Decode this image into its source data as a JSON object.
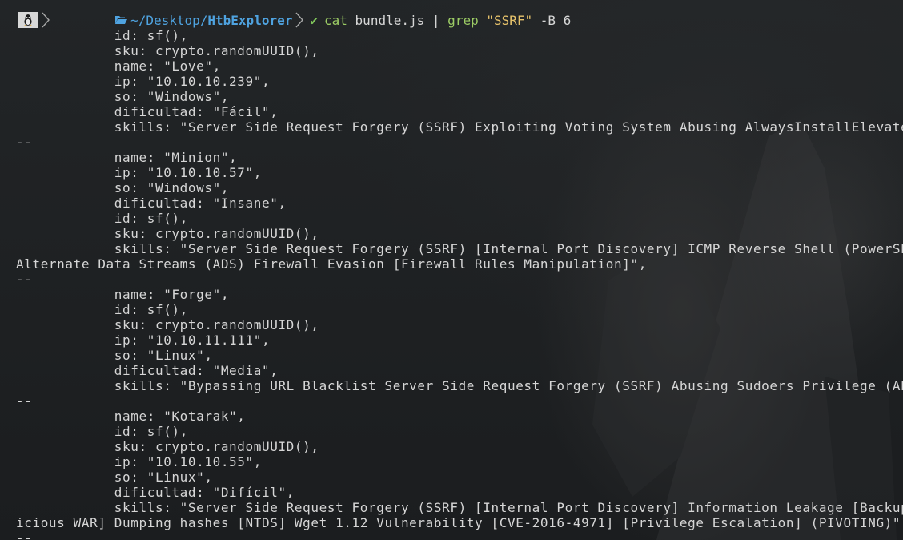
{
  "prompt": {
    "os_icon": "linux-tux-icon",
    "path_icon": "folder-open-icon",
    "path_prefix": "~/Desktop/",
    "path_dir": "HtbExplorer",
    "status_icon": "check-icon",
    "status_glyph": "✔",
    "command": {
      "bin": "cat",
      "file": "bundle.js",
      "pipe": "|",
      "grep": "grep",
      "pattern": "\"SSRF\"",
      "flags": "-B 6"
    }
  },
  "output": [
    "            id: sf(),",
    "            sku: crypto.randomUUID(),",
    "            name: \"Love\",",
    "            ip: \"10.10.10.239\",",
    "            so: \"Windows\",",
    "            dificultad: \"Fácil\",",
    "            skills: \"Server Side Request Forgery (SSRF) Exploiting Voting System Abusing AlwaysInstallElevated",
    "--",
    "            name: \"Minion\",",
    "            ip: \"10.10.10.57\",",
    "            so: \"Windows\",",
    "            dificultad: \"Insane\",",
    "            id: sf(),",
    "            sku: crypto.randomUUID(),",
    "            skills: \"Server Side Request Forgery (SSRF) [Internal Port Discovery] ICMP Reverse Shell (PowerShel",
    "Alternate Data Streams (ADS) Firewall Evasion [Firewall Rules Manipulation]\",",
    "--",
    "            name: \"Forge\",",
    "            id: sf(),",
    "            sku: crypto.randomUUID(),",
    "            ip: \"10.10.11.111\",",
    "            so: \"Linux\",",
    "            dificultad: \"Media\",",
    "            skills: \"Bypassing URL Blacklist Server Side Request Forgery (SSRF) Abusing Sudoers Privilege (Abus",
    "--",
    "            name: \"Kotarak\",",
    "            id: sf(),",
    "            sku: crypto.randomUUID(),",
    "            ip: \"10.10.10.55\",",
    "            so: \"Linux\",",
    "            dificultad: \"Difícil\",",
    "            skills: \"Server Side Request Forgery (SSRF) [Internal Port Discovery] Information Leakage [Backup]",
    "icious WAR] Dumping hashes [NTDS] Wget 1.12 Vulnerability [CVE-2016-4971] [Privilege Escalation] (PIVOTING)\",",
    "--"
  ],
  "colors": {
    "background": "#1f2224",
    "text": "#d6d6d6",
    "path": "#4fa3e0",
    "command": "#9ccc65",
    "string": "#e6c26b",
    "check": "#7fc45a"
  }
}
